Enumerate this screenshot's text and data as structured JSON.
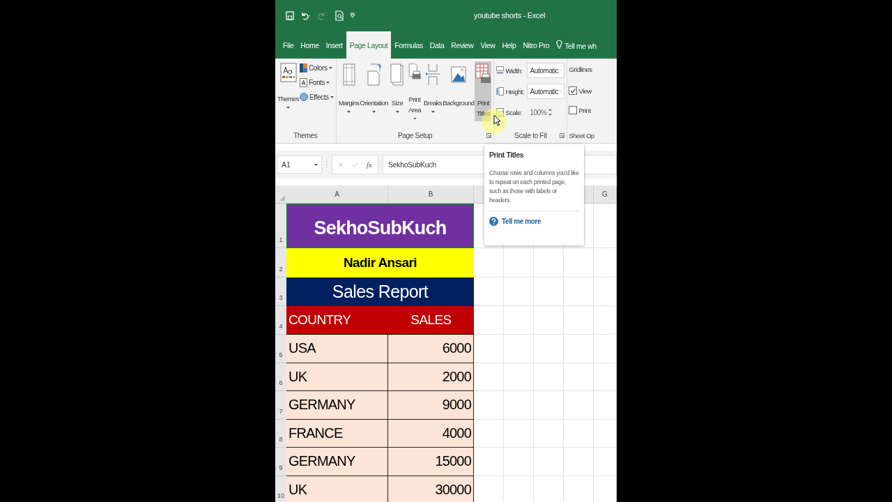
{
  "window": {
    "title": "youtube shorts  -  Excel"
  },
  "tabs": [
    {
      "label": "File",
      "selected": false
    },
    {
      "label": "Home",
      "selected": false
    },
    {
      "label": "Insert",
      "selected": false
    },
    {
      "label": "Page Layout",
      "selected": true
    },
    {
      "label": "Formulas",
      "selected": false
    },
    {
      "label": "Data",
      "selected": false
    },
    {
      "label": "Review",
      "selected": false
    },
    {
      "label": "View",
      "selected": false
    },
    {
      "label": "Help",
      "selected": false
    },
    {
      "label": "Nitro Pro",
      "selected": false
    }
  ],
  "tell_me": "Tell me wh",
  "ribbon": {
    "themes": {
      "label": "Themes",
      "large": {
        "label": "Themes",
        "dropdown": true
      },
      "items": [
        {
          "label": "Colors",
          "dropdown": true
        },
        {
          "label": "Fonts",
          "dropdown": true
        },
        {
          "label": "Effects",
          "dropdown": true
        }
      ]
    },
    "page_setup": {
      "label": "Page Setup",
      "buttons": [
        {
          "lines": [
            "Margins"
          ],
          "dropdown": true,
          "hovered": false
        },
        {
          "lines": [
            "Orientation"
          ],
          "dropdown": true,
          "hovered": false
        },
        {
          "lines": [
            "Size"
          ],
          "dropdown": true,
          "hovered": false
        },
        {
          "lines": [
            "Print",
            "Area"
          ],
          "dropdown": true,
          "hovered": false
        },
        {
          "lines": [
            "Breaks"
          ],
          "dropdown": true,
          "hovered": false
        },
        {
          "lines": [
            "Background"
          ],
          "dropdown": false,
          "hovered": false
        },
        {
          "lines": [
            "Print",
            "Titles"
          ],
          "dropdown": false,
          "hovered": true
        }
      ]
    },
    "scale_to_fit": {
      "label": "Scale to Fit",
      "rows": [
        {
          "label": "Width:",
          "value": "Automatic",
          "kind": "dropdown"
        },
        {
          "label": "Height:",
          "value": "Automatic",
          "kind": "dropdown"
        },
        {
          "label": "Scale:",
          "value": "100%",
          "kind": "spinner"
        }
      ]
    },
    "sheet_options": {
      "label": "Sheet Op",
      "heading": "Gridlines",
      "options": [
        {
          "label": "View",
          "checked": true
        },
        {
          "label": "Print",
          "checked": false
        }
      ]
    }
  },
  "formula_bar": {
    "name_box": "A1",
    "fx": "fx",
    "formula": "SekhoSubKuch"
  },
  "tooltip": {
    "title": "Print Titles",
    "body": "Choose rows and columns you'd like to repeat on each printed page, such as those with labels or headers.",
    "link": "Tell me more"
  },
  "sheet": {
    "columns": [
      {
        "label": "A"
      },
      {
        "label": "B"
      },
      {
        "label": "G"
      }
    ],
    "rows": [
      {
        "number": "1",
        "kind": "title",
        "selected": true,
        "cells": [
          "SekhoSubKuch"
        ]
      },
      {
        "number": "2",
        "kind": "subtitle",
        "selected": false,
        "cells": [
          "Nadir Ansari"
        ]
      },
      {
        "number": "3",
        "kind": "banner",
        "selected": false,
        "cells": [
          "Sales Report"
        ]
      },
      {
        "number": "4",
        "kind": "header",
        "selected": false,
        "cells": [
          "COUNTRY",
          "SALES"
        ]
      },
      {
        "number": "5",
        "kind": "data",
        "selected": false,
        "cells": [
          "USA",
          "6000"
        ]
      },
      {
        "number": "6",
        "kind": "data",
        "selected": false,
        "cells": [
          "UK",
          "2000"
        ]
      },
      {
        "number": "7",
        "kind": "data",
        "selected": false,
        "cells": [
          "GERMANY",
          "9000"
        ]
      },
      {
        "number": "8",
        "kind": "data",
        "selected": false,
        "cells": [
          "FRANCE",
          "4000"
        ]
      },
      {
        "number": "9",
        "kind": "data",
        "selected": false,
        "cells": [
          "GERMANY",
          "15000"
        ]
      },
      {
        "number": "10",
        "kind": "data",
        "selected": false,
        "cells": [
          "UK",
          "30000"
        ]
      }
    ]
  }
}
